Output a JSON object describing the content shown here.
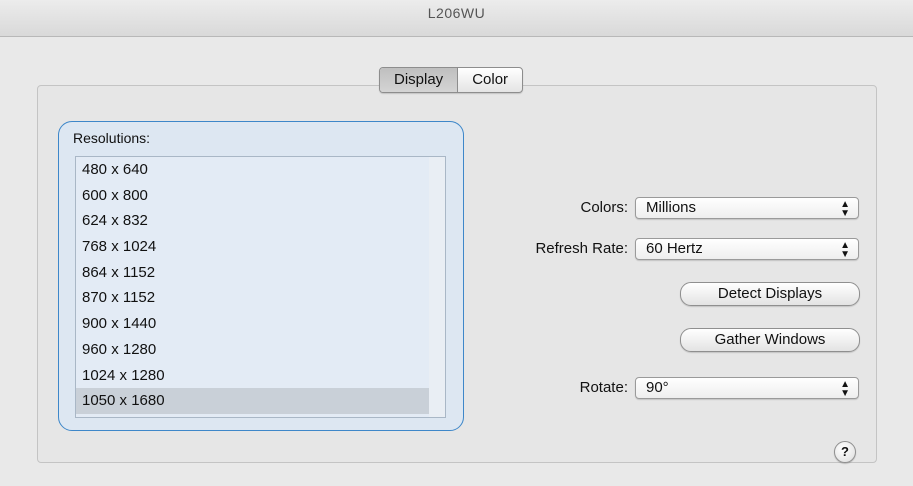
{
  "window": {
    "title": "L206WU"
  },
  "tabs": [
    {
      "label": "Display",
      "selected": true
    },
    {
      "label": "Color",
      "selected": false
    }
  ],
  "resolutions": {
    "label": "Resolutions:",
    "items": [
      "480 x 640",
      "600 x 800",
      "624 x 832",
      "768 x 1024",
      "864 x 1152",
      "870 x 1152",
      "900 x 1440",
      "960 x 1280",
      "1024 x 1280",
      "1050 x 1680"
    ],
    "selected": "1050 x 1680"
  },
  "colors": {
    "label": "Colors:",
    "value": "Millions"
  },
  "refresh_rate": {
    "label": "Refresh Rate:",
    "value": "60 Hertz"
  },
  "buttons": {
    "detect_displays": "Detect Displays",
    "gather_windows": "Gather Windows"
  },
  "rotate": {
    "label": "Rotate:",
    "value": "90°"
  },
  "help": {
    "symbol": "?"
  },
  "theme": {
    "focus_ring": "#3e87c9",
    "selection": "#c9d0d8"
  }
}
